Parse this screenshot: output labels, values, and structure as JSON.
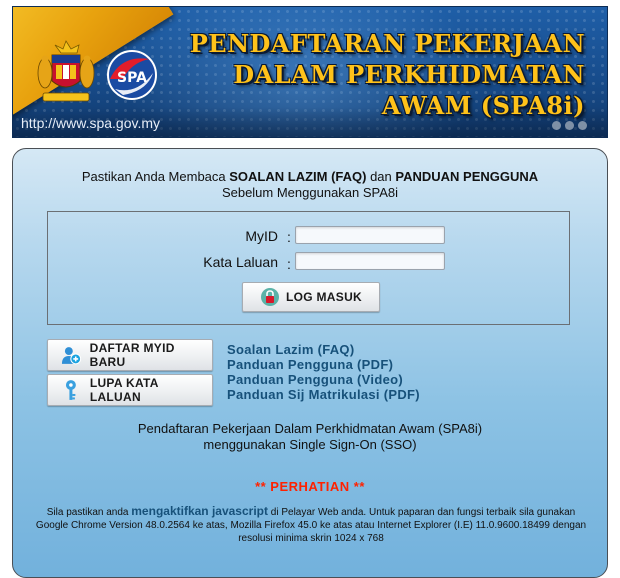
{
  "banner": {
    "title_line1": "PENDAFTARAN PEKERJAAN",
    "title_line2": "DALAM PERKHIDMATAN",
    "title_line3": "AWAM (SPA8i)",
    "url": "http://www.spa.gov.my",
    "logo_text": "SPA"
  },
  "login": {
    "notice_prefix": "Pastikan Anda Membaca ",
    "notice_faq": "SOALAN LAZIM (FAQ)",
    "notice_mid": " dan ",
    "notice_guide": "PANDUAN PENGGUNA",
    "notice_line2": "Sebelum Menggunakan SPA8i",
    "myid_label": "MyID",
    "password_label": "Kata Laluan",
    "colon": ":",
    "myid_value": "",
    "password_value": "",
    "login_button": "LOG MASUK"
  },
  "actions": {
    "register_button": "DAFTAR MYID BARU",
    "forgot_button": "LUPA KATA LALUAN"
  },
  "links": [
    "Soalan Lazim (FAQ)",
    "Panduan Pengguna (PDF)",
    "Panduan Pengguna (Video)",
    "Panduan Sij Matrikulasi (PDF)"
  ],
  "info": {
    "sso_line1": "Pendaftaran Pekerjaan Dalam Perkhidmatan Awam (SPA8i)",
    "sso_line2": "menggunakan Single Sign-On (SSO)",
    "attention": "** PERHATIAN **",
    "js_prefix": "Sila pastikan anda ",
    "js_highlight": "mengaktifkan javascript",
    "js_suffix": " di Pelayar Web anda. Untuk paparan dan fungsi terbaik sila gunakan Google Chrome Version 48.0.2564 ke atas, Mozilla Firefox 45.0 ke atas atau Internet Explorer (I.E) 11.0.9600.18499 dengan resolusi minima skrin 1024 x 768"
  },
  "colors": {
    "banner_blue": "#174c8c",
    "title_gold": "#ffc21a",
    "link_blue": "#17517a",
    "attention_red": "#ff2200"
  }
}
